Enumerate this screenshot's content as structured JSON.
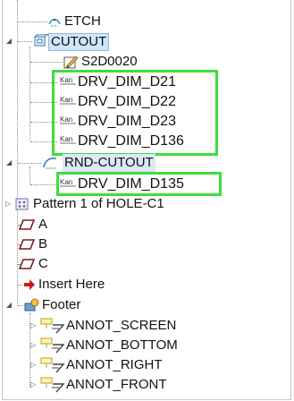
{
  "tree": {
    "etch": "ETCH",
    "cutout": "CUTOUT",
    "s2d": "S2D0020",
    "dims_group1": [
      "DRV_DIM_D21",
      "DRV_DIM_D22",
      "DRV_DIM_D23",
      "DRV_DIM_D136"
    ],
    "rnd_cutout": "RND-CUTOUT",
    "dim_d135": "DRV_DIM_D135",
    "pattern": "Pattern 1 of HOLE-C1",
    "sketches": [
      "A",
      "B",
      "C"
    ],
    "insert_here": "Insert Here",
    "footer": "Footer",
    "annots": [
      "ANNOT_SCREEN",
      "ANNOT_BOTTOM",
      "ANNOT_RIGHT",
      "ANNOT_FRONT"
    ]
  },
  "colors": {
    "highlight_box": "#3cde3c",
    "selection": "#cfe6fb",
    "insert_arrow": "#d0161a"
  }
}
